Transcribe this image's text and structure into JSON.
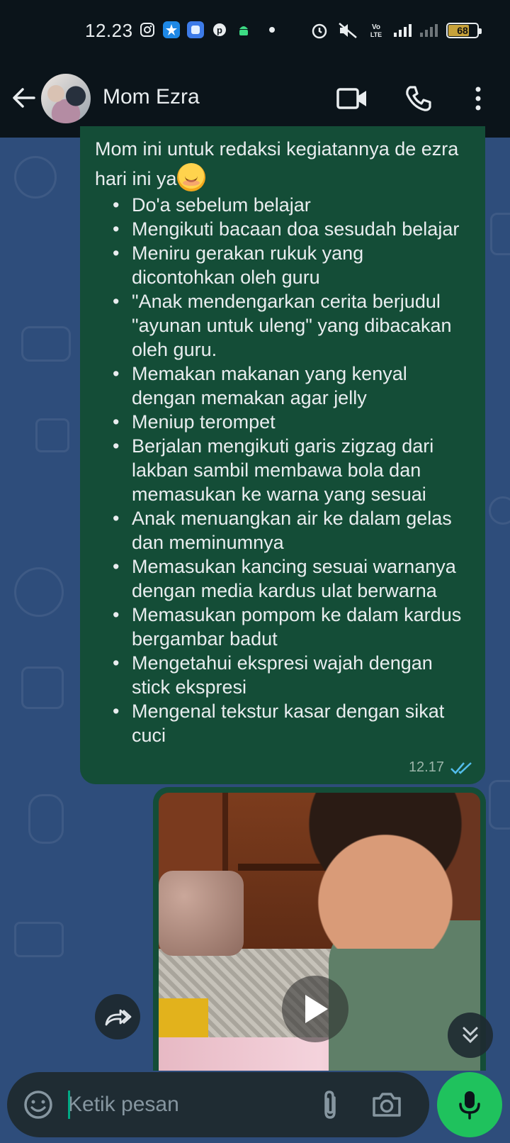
{
  "status_bar": {
    "time": "12.23",
    "battery_level": "68",
    "battery_fraction": 0.68,
    "network_label": "Vo LTE",
    "notification_icons": [
      "instagram-icon",
      "star-app-icon",
      "blue-app-icon",
      "pinterest-icon",
      "android-icon"
    ],
    "system_icons": [
      "alarm-icon",
      "mute-icon",
      "volte-icon",
      "signal-icon",
      "signal-icon-2",
      "battery-icon"
    ]
  },
  "header": {
    "contact_name": "Mom Ezra",
    "icons": [
      "back-arrow-icon",
      "video-call-icon",
      "voice-call-icon",
      "more-vert-icon"
    ]
  },
  "message": {
    "intro": "Mom ini untuk redaksi kegiatannya de ezra hari ini ya",
    "items": [
      "Do'a sebelum belajar",
      "Mengikuti bacaan doa sesudah belajar",
      "Meniru gerakan rukuk yang dicontohkan oleh guru",
      "\"Anak mendengarkan cerita berjudul \"ayunan untuk uleng\" yang dibacakan oleh guru.",
      "Memakan makanan yang kenyal dengan memakan agar jelly",
      "Meniup terompet",
      "Berjalan mengikuti garis zigzag dari lakban sambil membawa bola dan memasukan ke warna yang sesuai",
      "Anak menuangkan air ke dalam gelas dan meminumnya",
      "Memasukan kancing sesuai warnanya dengan media kardus ulat berwarna",
      "Memasukan pompom ke dalam kardus bergambar badut",
      "Mengetahui ekspresi wajah dengan stick ekspresi",
      "Mengenal tekstur kasar dengan sikat cuci"
    ],
    "time": "12.17",
    "status": "read"
  },
  "composer": {
    "placeholder": "Ketik pesan"
  },
  "colors": {
    "bar_bg": "#0b141a",
    "chat_bg": "#2e4d7b",
    "bubble_out": "#144d37",
    "accent": "#1fc25d",
    "read_ticks": "#53bdeb"
  }
}
